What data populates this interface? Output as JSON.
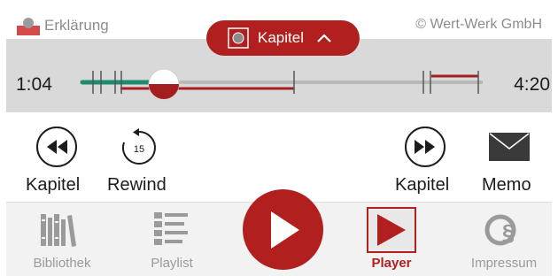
{
  "header": {
    "left_label": "Erklärung",
    "right_label": "© Wert-Werk GmbH"
  },
  "chapter_button": {
    "label": "Kapitel",
    "icon": "chevron-up-icon"
  },
  "player": {
    "current_time": "1:04",
    "total_time": "4:20",
    "progress": 0.25
  },
  "controls": {
    "prev_label": "Kapitel",
    "rewind_label": "Rewind",
    "rewind_seconds": "15",
    "next_label": "Kapitel",
    "memo_label": "Memo"
  },
  "tabs": [
    {
      "label": "Bibliothek",
      "icon": "books-icon",
      "active": false
    },
    {
      "label": "Playlist",
      "icon": "list-icon",
      "active": false
    },
    {
      "label": "Player",
      "icon": "play-icon",
      "active": true
    },
    {
      "label": "Impressum",
      "icon": "copyright-section-icon",
      "active": false
    }
  ],
  "colors": {
    "accent": "#b21f1f",
    "teal": "#1e8a6e",
    "strip": "#d9d9d9",
    "muted": "#9a9a9a"
  }
}
